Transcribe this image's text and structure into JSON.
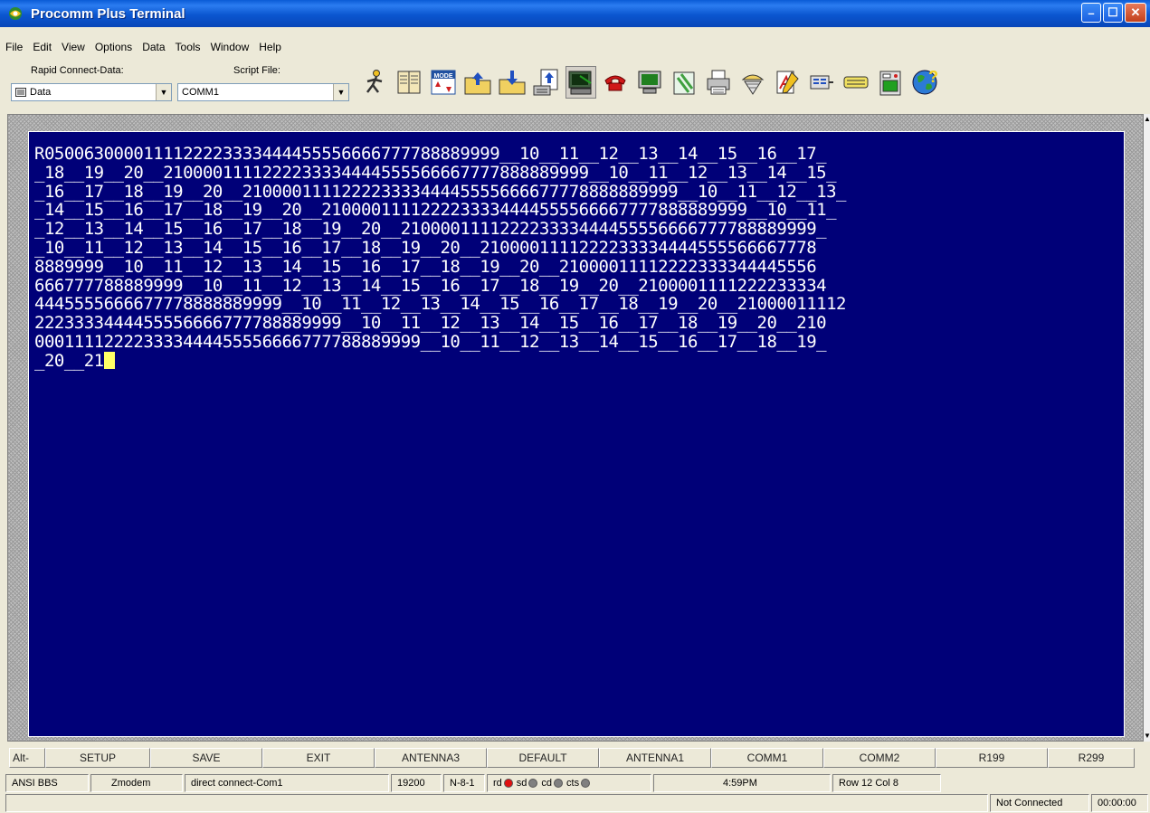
{
  "window": {
    "title": "Procomm Plus Terminal"
  },
  "menu": [
    "File",
    "Edit",
    "View",
    "Options",
    "Data",
    "Tools",
    "Window",
    "Help"
  ],
  "toolbar": {
    "rapid_connect_label": "Rapid Connect-Data:",
    "rapid_connect_value": "Data",
    "script_file_label": "Script File:",
    "script_file_value": "COMM1",
    "icons": [
      "run-script-icon",
      "phonebook-icon",
      "mode-icon",
      "send-file-icon",
      "receive-file-icon",
      "upload-icon",
      "terminal-icon",
      "disconnect-phone-icon",
      "monitor-icon",
      "clipboard-icon",
      "printer-icon",
      "capture-icon",
      "editor-icon",
      "key-icon",
      "setup-icon",
      "meter-icon",
      "help-globe-icon"
    ]
  },
  "terminal": {
    "lines": [
      "R0500630000111122223333444455556666777788889999__10__11__12__13__14__15__16__17_",
      "_18__19__20__2100001111222233334444555566667777888889999__10__11__12__13__14__15_",
      "_16__17__18__19__20__21000011112222333344445555666677778888889999__10__11__12__13_",
      "_14__15__16__17__18__19__20__2100001111222233334444555566667777888889999__10__11_",
      "_12__13__14__15__16__17__18__19__20__210000111122223333444455556666777788889999_",
      "_10__11__12__13__14__15__16__17__18__19__20__2100001111222233334444555566667778",
      "8889999__10__11__12__13__14__15__16__17__18__19__20__21000011112222333344445556",
      "666777788889999__10__11__12__13__14__15__16__17__18__19__20__2100001111222233334",
      "4445555666677778888889999__10__11__12__13__14__15__16__17__18__19__20__21000011112",
      "2223333444455556666777788889999__10__11__12__13__14__15__16__17__18__19__20__210",
      "000111122223333444455556666777788889999__10__11__12__13__14__15__16__17__18__19_",
      "_20__21"
    ]
  },
  "fkeys": {
    "alt_label": "Alt-",
    "keys": [
      "SETUP",
      "SAVE",
      "EXIT",
      "ANTENNA3",
      "DEFAULT",
      "ANTENNA1",
      "COMM1",
      "COMM2",
      "R199",
      "R299"
    ]
  },
  "status": {
    "emulation": "ANSI BBS",
    "protocol": "Zmodem",
    "connection": "direct connect-Com1",
    "baud": "19200",
    "parity": "N-8-1",
    "leds": [
      {
        "label": "rd",
        "color": "#e01010"
      },
      {
        "label": "sd",
        "color": "#808080"
      },
      {
        "label": "cd",
        "color": "#808080"
      },
      {
        "label": "cts",
        "color": "#808080"
      }
    ],
    "time": "4:59PM",
    "position": "Row 12   Col 8",
    "connection_state": "Not Connected",
    "elapsed": "00:00:00"
  }
}
